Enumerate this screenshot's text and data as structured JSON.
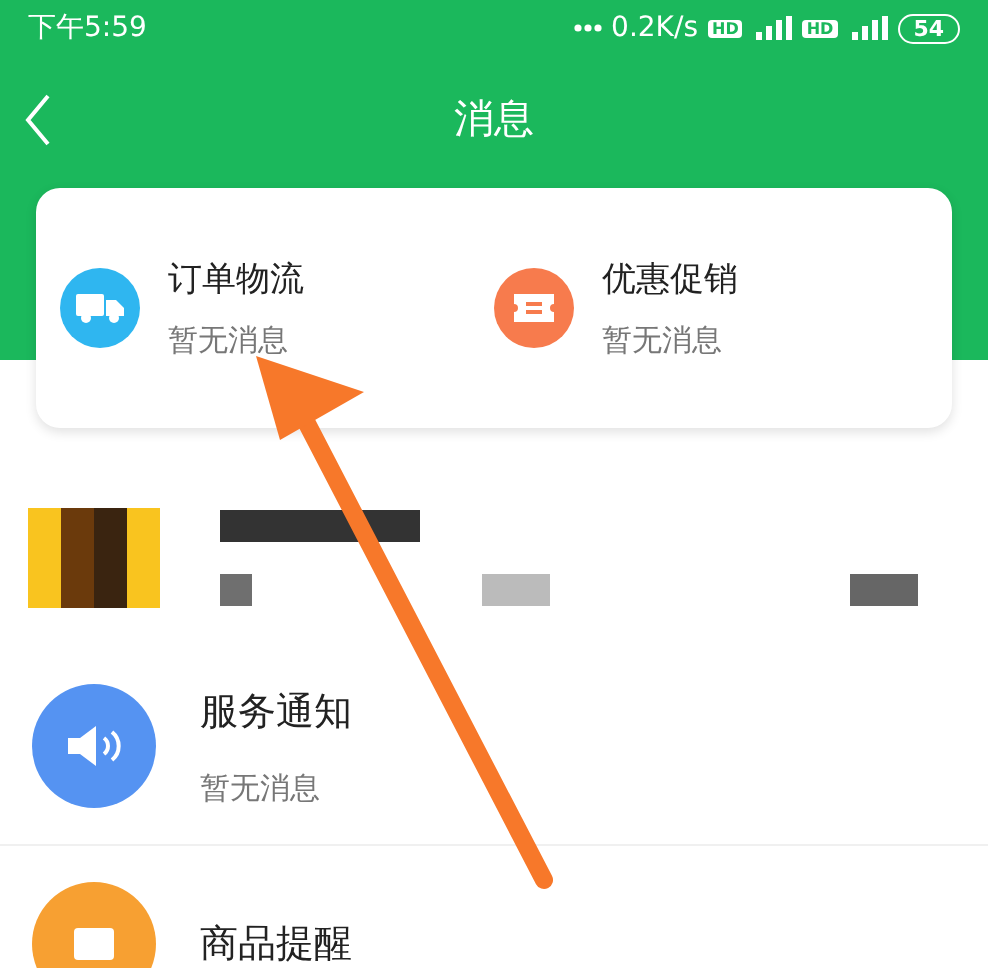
{
  "status_bar": {
    "time": "下午5:59",
    "speed": "0.2K/s",
    "badges": [
      "HD",
      "HD"
    ],
    "battery": "54"
  },
  "header": {
    "title": "消息"
  },
  "quick_cards": [
    {
      "kind": "logistics",
      "title": "订单物流",
      "subtitle": "暂无消息",
      "color": "#2fb6f0"
    },
    {
      "kind": "promo",
      "title": "优惠促销",
      "subtitle": "暂无消息",
      "color": "#f77b4d"
    }
  ],
  "messages": [
    {
      "kind": "service",
      "title": "服务通知",
      "subtitle": "暂无消息",
      "color": "#5593f2"
    },
    {
      "kind": "product",
      "title": "商品提醒",
      "color": "#f7a032"
    }
  ]
}
